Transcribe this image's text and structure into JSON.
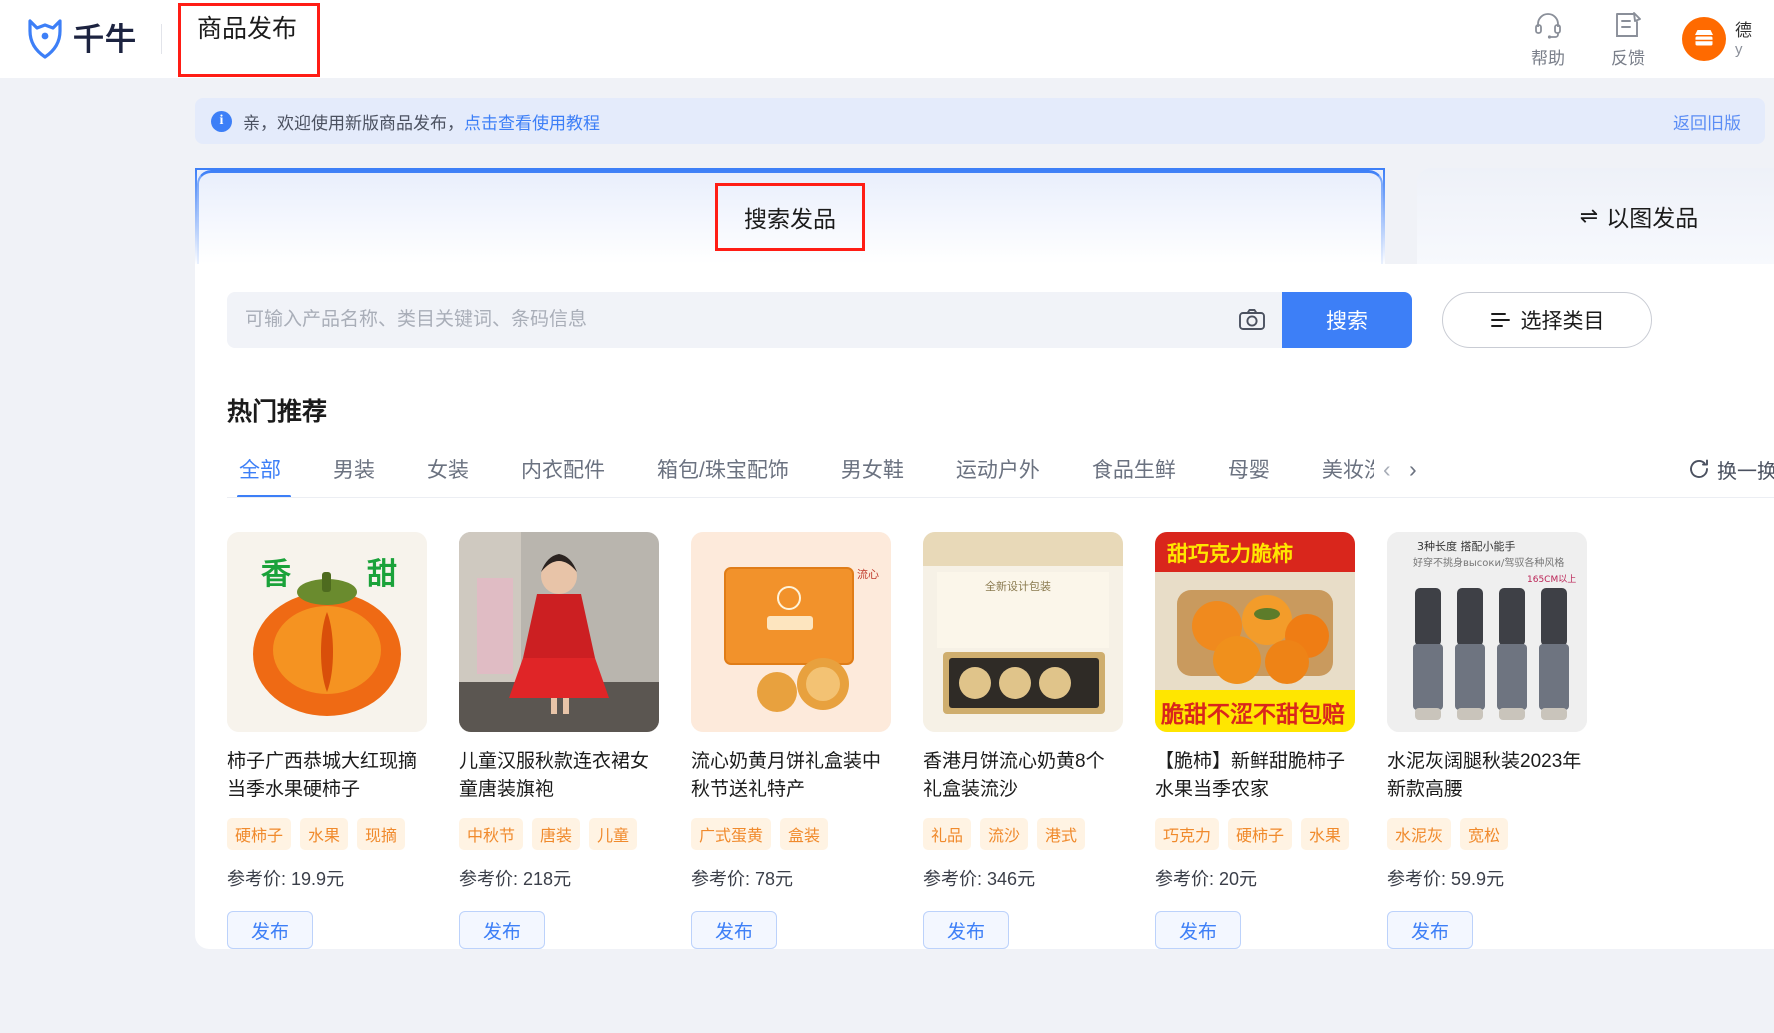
{
  "header": {
    "brand_name": "千牛",
    "page_title": "商品发布",
    "actions": [
      {
        "icon": "headset-icon",
        "label": "帮助"
      },
      {
        "icon": "feedback-icon",
        "label": "反馈"
      }
    ],
    "user": {
      "name": "德",
      "sub": "y"
    }
  },
  "notice": {
    "text": "亲，欢迎使用新版商品发布，",
    "link": "点击查看使用教程",
    "right_link": "返回旧版",
    "icon": "info-icon"
  },
  "tabs": {
    "main": {
      "label": "搜索发品",
      "active": true
    },
    "side": {
      "label": "以图发品",
      "icon": "swap-icon",
      "active": false
    }
  },
  "search": {
    "placeholder": "可输入产品名称、类目关键词、条码信息",
    "value": "",
    "camera_icon": "camera-icon",
    "button_label": "搜索",
    "category_button": {
      "label": "选择类目",
      "icon": "list-icon"
    }
  },
  "hot": {
    "title": "热门推荐",
    "refresh_label": "换一换",
    "refresh_icon": "refresh-icon",
    "prev_icon": "chevron-left-icon",
    "next_icon": "chevron-right-icon",
    "categories": [
      {
        "label": "全部",
        "active": true
      },
      {
        "label": "男装",
        "active": false
      },
      {
        "label": "女装",
        "active": false
      },
      {
        "label": "内衣配件",
        "active": false
      },
      {
        "label": "箱包/珠宝配饰",
        "active": false
      },
      {
        "label": "男女鞋",
        "active": false
      },
      {
        "label": "运动户外",
        "active": false
      },
      {
        "label": "食品生鲜",
        "active": false
      },
      {
        "label": "母婴",
        "active": false
      },
      {
        "label": "美妆洗护",
        "active": false
      }
    ],
    "products": [
      {
        "title": "柿子广西恭城大红现摘当季水果硬柿子",
        "tags": [
          "硬柿子",
          "水果",
          "现摘"
        ],
        "price_label": "参考价:",
        "price": "19.9元",
        "publish_label": "发布",
        "image": "persimmon-sliced"
      },
      {
        "title": "儿童汉服秋款连衣裙女童唐装旗袍",
        "tags": [
          "中秋节",
          "唐装",
          "儿童"
        ],
        "price_label": "参考价:",
        "price": "218元",
        "publish_label": "发布",
        "image": "red-dress-girl"
      },
      {
        "title": "流心奶黄月饼礼盒装中秋节送礼特产",
        "tags": [
          "广式蛋黄",
          "盒装"
        ],
        "price_label": "参考价:",
        "price": "78元",
        "publish_label": "发布",
        "image": "mooncake-orange-box"
      },
      {
        "title": "香港月饼流心奶黄8个礼盒装流沙",
        "tags": [
          "礼品",
          "流沙",
          "港式"
        ],
        "price_label": "参考价:",
        "price": "346元",
        "publish_label": "发布",
        "image": "mooncake-gift-set"
      },
      {
        "title": "【脆柿】新鲜甜脆柿子水果当季农家",
        "tags": [
          "巧克力",
          "硬柿子",
          "水果"
        ],
        "price_label": "参考价:",
        "price": "20元",
        "publish_label": "发布",
        "image": "persimmon-bowl"
      },
      {
        "title": "水泥灰阔腿秋装2023年新款高腰",
        "tags": [
          "水泥灰",
          "宽松"
        ],
        "price_label": "参考价:",
        "price": "59.9元",
        "publish_label": "发布",
        "image": "grey-pants-models"
      }
    ]
  },
  "colors": {
    "accent": "#3d7ff7",
    "highlight_box": "#ff1d15",
    "tag_text": "#f08a2c",
    "tag_bg": "#fff3e3",
    "brand_orange": "#ff6a00"
  }
}
